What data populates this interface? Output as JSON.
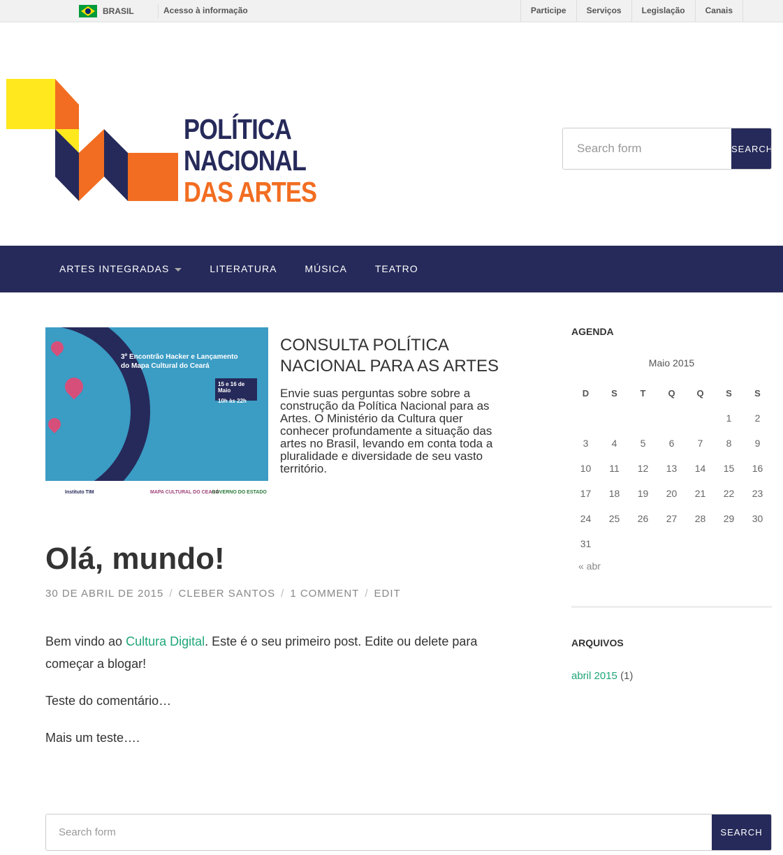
{
  "govbar": {
    "country": "BRASIL",
    "access": "Acesso à informação",
    "links": [
      "Participe",
      "Serviços",
      "Legislação",
      "Canais"
    ]
  },
  "logo": {
    "line1": "POLÍTICA",
    "line2": "NACIONAL",
    "line3": "DAS ARTES"
  },
  "header_search": {
    "placeholder": "Search form",
    "button": "SEARCH"
  },
  "nav": {
    "items": [
      "ARTES INTEGRADAS",
      "LITERATURA",
      "MÚSICA",
      "TEATRO"
    ]
  },
  "featured": {
    "image_title_line1": "3º Encontrão Hacker e Lançamento",
    "image_title_line2": "do Mapa Cultural do Ceará",
    "image_dates": "15 e 16 de Maio",
    "image_time": "10h às 22h",
    "image_footer": [
      "Instituto TIM",
      "MAPA CULTURAL DO CEARÁ",
      "GOVERNO DO ESTADO"
    ],
    "title": "CONSULTA POLÍTICA NACIONAL PARA AS ARTES",
    "excerpt": "Envie suas perguntas sobre sobre a construção da Política Nacional para as Artes. O Ministério da Cultura quer conhecer profundamente a situação das artes no Brasil, levando em conta toda a pluralidade e diversidade de seu vasto território."
  },
  "post": {
    "title": "Olá, mundo!",
    "date": "30 DE ABRIL DE 2015",
    "author": "CLEBER SANTOS",
    "comments": "1 COMMENT",
    "edit": "EDIT",
    "p1_before": "Bem vindo ao ",
    "p1_link": "Cultura Digital",
    "p1_after": ". Este é o seu primeiro post. Edite ou delete para começar a blogar!",
    "p2": "Teste do comentário…",
    "p3": "Mais um teste…."
  },
  "agenda": {
    "title": "AGENDA",
    "caption": "Maio 2015",
    "weekdays": [
      "D",
      "S",
      "T",
      "Q",
      "Q",
      "S",
      "S"
    ],
    "weeks": [
      [
        "",
        "",
        "",
        "",
        "",
        "1",
        "2"
      ],
      [
        "3",
        "4",
        "5",
        "6",
        "7",
        "8",
        "9"
      ],
      [
        "10",
        "11",
        "12",
        "13",
        "14",
        "15",
        "16"
      ],
      [
        "17",
        "18",
        "19",
        "20",
        "21",
        "22",
        "23"
      ],
      [
        "24",
        "25",
        "26",
        "27",
        "28",
        "29",
        "30"
      ],
      [
        "31",
        "",
        "",
        "",
        "",
        "",
        ""
      ]
    ],
    "prev": "« abr"
  },
  "archives": {
    "title": "ARQUIVOS",
    "link": "abril 2015",
    "count": "(1)"
  },
  "footer_search": {
    "placeholder": "Search form",
    "button": "SEARCH"
  },
  "colors": {
    "navy": "#262a5a",
    "orange": "#f26d21",
    "yellow": "#ffe81e",
    "link": "#1fa67a"
  }
}
